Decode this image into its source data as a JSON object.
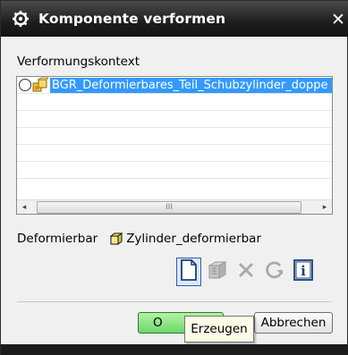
{
  "window": {
    "title": "Komponente verformen",
    "close_glyph": "✕",
    "title_icon": "gear-icon"
  },
  "context": {
    "label": "Verformungskontext",
    "items": [
      {
        "label": "BGR_Deformierbares_Teil_Schubzylinder_doppe",
        "selected": true,
        "icon": "assembly-icon"
      }
    ],
    "scroll_left_glyph": "◂",
    "scroll_right_glyph": "▸",
    "scroll_thumb_glyph": "III"
  },
  "deformable": {
    "label": "Deformierbar",
    "value": "Zylinder_deformierbar",
    "icon": "part-cube-icon"
  },
  "toolbar": {
    "buttons": [
      {
        "name": "new-document-button",
        "icon": "document-icon",
        "enabled": true
      },
      {
        "name": "component-button",
        "icon": "component-icon",
        "enabled": false
      },
      {
        "name": "delete-button",
        "icon": "x-icon",
        "enabled": false
      },
      {
        "name": "refresh-button",
        "icon": "refresh-icon",
        "enabled": false
      },
      {
        "name": "info-button",
        "icon": "info-icon",
        "enabled": true
      }
    ],
    "info_glyph": "i"
  },
  "buttons": {
    "ok_label": "O",
    "cancel_label": "Abbrechen"
  },
  "tooltip": {
    "text": "Erzeugen"
  },
  "colors": {
    "selection": "#3399ff",
    "ok_green": "#6ad86a",
    "titlebar": "#1d1d1d"
  }
}
